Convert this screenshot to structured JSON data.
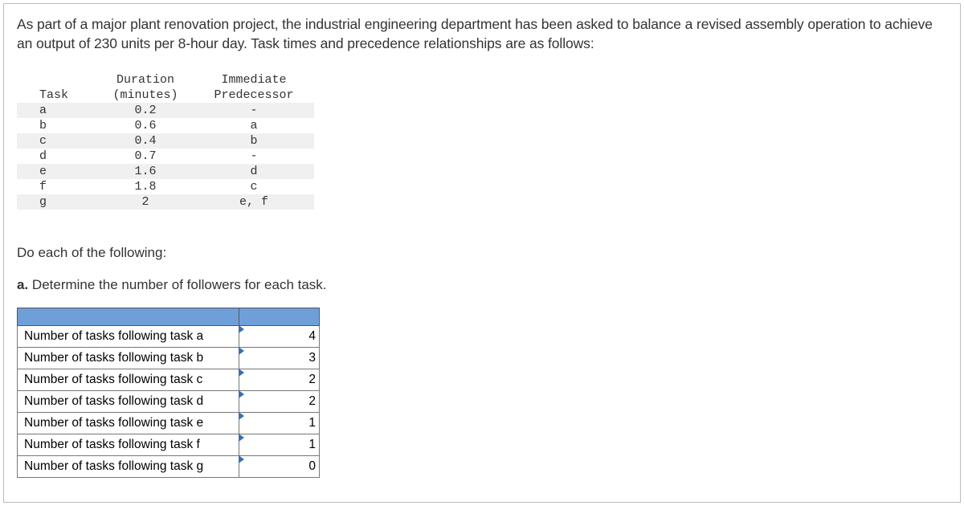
{
  "intro": "As part of a major plant renovation project, the industrial engineering department has been asked to balance a revised assembly operation to achieve an output of 230 units per 8-hour day. Task times and precedence relationships are as follows:",
  "task_table": {
    "headers": {
      "task": "Task",
      "duration1": "Duration",
      "duration2": "(minutes)",
      "pred1": "Immediate",
      "pred2": "Predecessor"
    },
    "rows": [
      {
        "task": "a",
        "duration": "0.2",
        "pred": "-"
      },
      {
        "task": "b",
        "duration": "0.6",
        "pred": "a"
      },
      {
        "task": "c",
        "duration": "0.4",
        "pred": "b"
      },
      {
        "task": "d",
        "duration": "0.7",
        "pred": "-"
      },
      {
        "task": "e",
        "duration": "1.6",
        "pred": "d"
      },
      {
        "task": "f",
        "duration": "1.8",
        "pred": "c"
      },
      {
        "task": "g",
        "duration": "2",
        "pred": "e, f"
      }
    ]
  },
  "section_head": "Do each of the following:",
  "question_prefix": "a.",
  "question_text": " Determine the number of followers for each task.",
  "answers": {
    "rows": [
      {
        "label": "Number of tasks following task a",
        "value": "4"
      },
      {
        "label": "Number of tasks following task b",
        "value": "3"
      },
      {
        "label": "Number of tasks following task c",
        "value": "2"
      },
      {
        "label": "Number of tasks following task d",
        "value": "2"
      },
      {
        "label": "Number of tasks following task e",
        "value": "1"
      },
      {
        "label": "Number of tasks following task f",
        "value": "1"
      },
      {
        "label": "Number of tasks following task g",
        "value": "0"
      }
    ]
  },
  "chart_data": {
    "type": "table",
    "title": "Task durations and precedence",
    "columns": [
      "Task",
      "Duration (minutes)",
      "Immediate Predecessor"
    ],
    "rows": [
      [
        "a",
        0.2,
        "-"
      ],
      [
        "b",
        0.6,
        "a"
      ],
      [
        "c",
        0.4,
        "b"
      ],
      [
        "d",
        0.7,
        "-"
      ],
      [
        "e",
        1.6,
        "d"
      ],
      [
        "f",
        1.8,
        "c"
      ],
      [
        "g",
        2,
        "e, f"
      ]
    ],
    "followers": {
      "a": 4,
      "b": 3,
      "c": 2,
      "d": 2,
      "e": 1,
      "f": 1,
      "g": 0
    }
  }
}
